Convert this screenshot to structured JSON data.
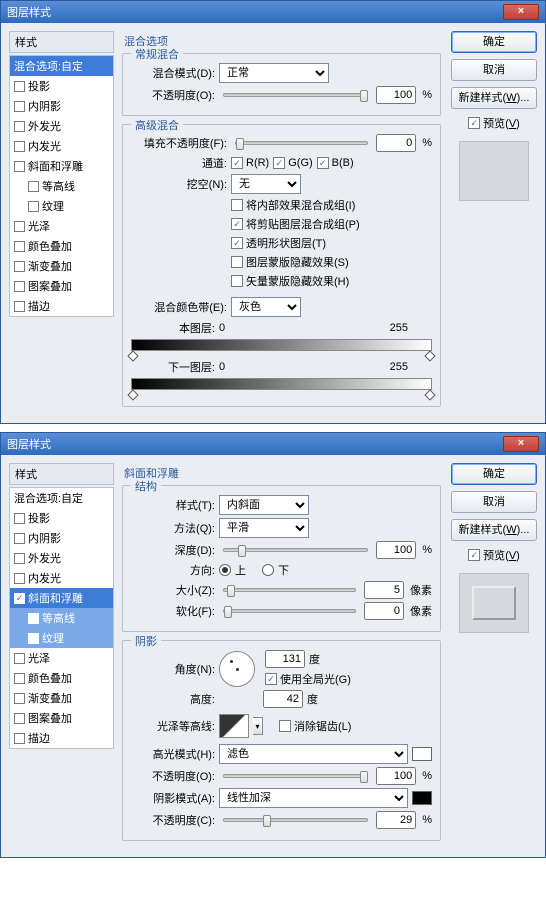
{
  "d1": {
    "title": "图层样式",
    "styles_header": "样式",
    "styles": [
      {
        "label": "混合选项:自定",
        "sel": true,
        "cb": false
      },
      {
        "label": "投影",
        "cb": true
      },
      {
        "label": "内阴影",
        "cb": true
      },
      {
        "label": "外发光",
        "cb": true
      },
      {
        "label": "内发光",
        "cb": true
      },
      {
        "label": "斜面和浮雕",
        "cb": true
      },
      {
        "label": "等高线",
        "cb": true,
        "indent": true
      },
      {
        "label": "纹理",
        "cb": true,
        "indent": true
      },
      {
        "label": "光泽",
        "cb": true
      },
      {
        "label": "颜色叠加",
        "cb": true
      },
      {
        "label": "渐变叠加",
        "cb": true
      },
      {
        "label": "图案叠加",
        "cb": true
      },
      {
        "label": "描边",
        "cb": true
      }
    ],
    "main_title": "混合选项",
    "g_normal": "常规混合",
    "blendmode_l": "混合模式(D):",
    "blendmode_v": "正常",
    "opacity_l": "不透明度(O):",
    "opacity_v": "100",
    "g_adv": "高级混合",
    "fillopacity_l": "填充不透明度(F):",
    "fillopacity_v": "0",
    "channels_l": "通道:",
    "ch_r": "R(R)",
    "ch_g": "G(G)",
    "ch_b": "B(B)",
    "knockout_l": "挖空(N):",
    "knockout_v": "无",
    "adv_opts": [
      {
        "label": "将内部效果混合成组(I)",
        "ck": false
      },
      {
        "label": "将剪贴图层混合成组(P)",
        "ck": true
      },
      {
        "label": "透明形状图层(T)",
        "ck": true
      },
      {
        "label": "图层蒙版隐藏效果(S)",
        "ck": false
      },
      {
        "label": "矢量蒙版隐藏效果(H)",
        "ck": false
      }
    ],
    "blendif_l": "混合颜色带(E):",
    "blendif_v": "灰色",
    "thislayer": "本图层:",
    "nextlayer": "下一图层:",
    "rng0": "0",
    "rng1": "255",
    "btn_ok": "确定",
    "btn_cancel": "取消",
    "btn_new": "新建样式(W)...",
    "preview_l": "预览(V)"
  },
  "d2": {
    "title": "图层样式",
    "styles_header": "样式",
    "styles": [
      {
        "label": "混合选项:自定",
        "cb": false
      },
      {
        "label": "投影",
        "cb": true
      },
      {
        "label": "内阴影",
        "cb": true
      },
      {
        "label": "外发光",
        "cb": true
      },
      {
        "label": "内发光",
        "cb": true
      },
      {
        "label": "斜面和浮雕",
        "cb": true,
        "ck": true,
        "sel": true
      },
      {
        "label": "等高线",
        "cb": true,
        "indent": true,
        "sub": true
      },
      {
        "label": "纹理",
        "cb": true,
        "indent": true,
        "sub": true
      },
      {
        "label": "光泽",
        "cb": true
      },
      {
        "label": "颜色叠加",
        "cb": true
      },
      {
        "label": "渐变叠加",
        "cb": true
      },
      {
        "label": "图案叠加",
        "cb": true
      },
      {
        "label": "描边",
        "cb": true
      }
    ],
    "main_title": "斜面和浮雕",
    "g_struct": "结构",
    "style_l": "样式(T):",
    "style_v": "内斜面",
    "tech_l": "方法(Q):",
    "tech_v": "平滑",
    "depth_l": "深度(D):",
    "depth_v": "100",
    "dir_l": "方向:",
    "dir_up": "上",
    "dir_down": "下",
    "size_l": "大小(Z):",
    "size_v": "5",
    "px": "像素",
    "soft_l": "软化(F):",
    "soft_v": "0",
    "g_shade": "阴影",
    "angle_l": "角度(N):",
    "angle_v": "131",
    "deg": "度",
    "global_l": "使用全局光(G)",
    "alt_l": "高度:",
    "alt_v": "42",
    "gloss_l": "光泽等高线:",
    "aa_l": "消除锯齿(L)",
    "hi_l": "高光模式(H):",
    "hi_v": "滤色",
    "hi_op_l": "不透明度(O):",
    "hi_op_v": "100",
    "sh_l": "阴影模式(A):",
    "sh_v": "线性加深",
    "sh_op_l": "不透明度(C):",
    "sh_op_v": "29",
    "btn_ok": "确定",
    "btn_cancel": "取消",
    "btn_new": "新建样式(W)...",
    "preview_l": "预览(V)"
  }
}
